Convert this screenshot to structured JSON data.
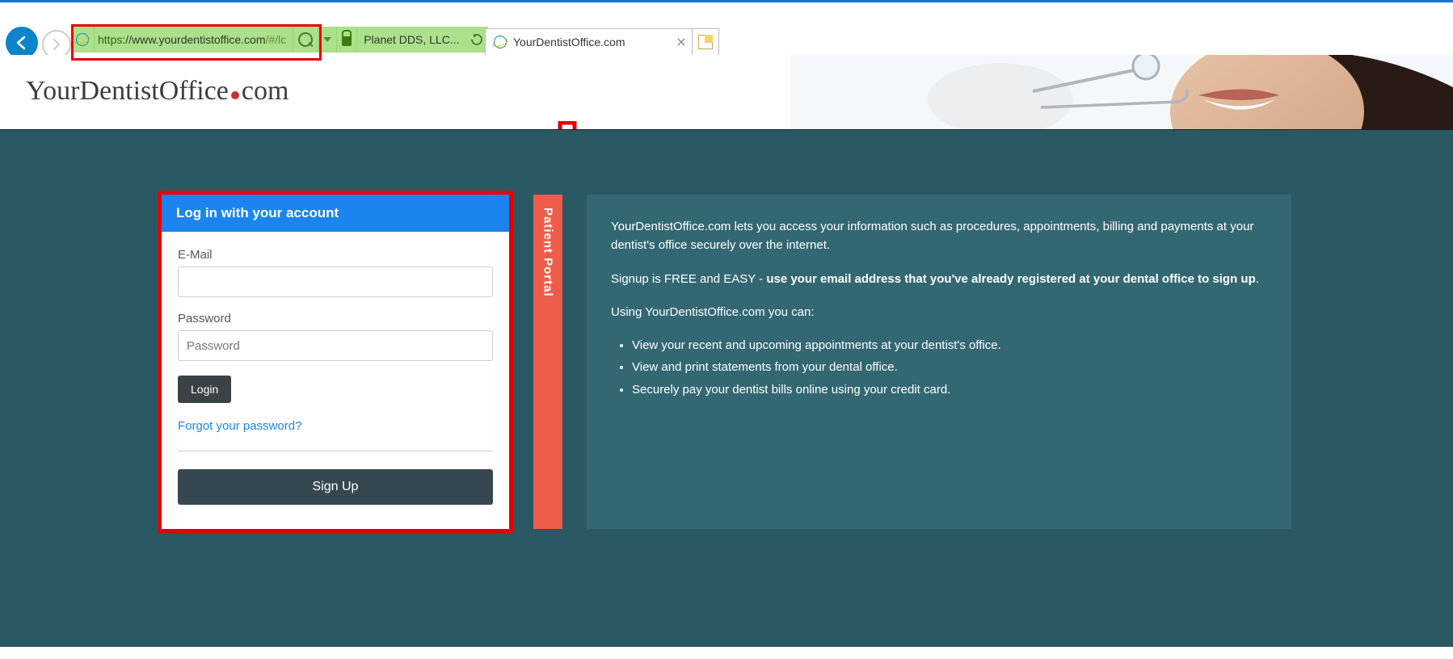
{
  "browser": {
    "url_https": "https",
    "url_host": "://www.yourdentistoffice.com",
    "url_path": "/#/lc",
    "tab1_title": "Planet DDS, LLC...",
    "tab2_title": "YourDentistOffice.com"
  },
  "logo": {
    "part1": "YourDentistOffice",
    "part2": "com"
  },
  "vert_tab_label": "Patient Portal",
  "login": {
    "header": "Log in with your account",
    "email_label": "E-Mail",
    "password_label": "Password",
    "password_placeholder": "Password",
    "login_btn": "Login",
    "forgot": "Forgot your password?",
    "signup_btn": "Sign Up"
  },
  "info": {
    "p1": "YourDentistOffice.com lets you access your information such as procedures, appointments, billing and payments at your dentist's office securely over the internet.",
    "p2_prefix": "Signup is FREE and EASY - ",
    "p2_bold": "use your email address that you've already registered at your dental office to sign up",
    "p2_suffix": ".",
    "p3": "Using YourDentistOffice.com you can:",
    "bullets": [
      "View your recent and upcoming appointments at your dentist's office.",
      "View and print statements from your dental office.",
      "Securely pay your dentist bills online using your credit card."
    ]
  }
}
